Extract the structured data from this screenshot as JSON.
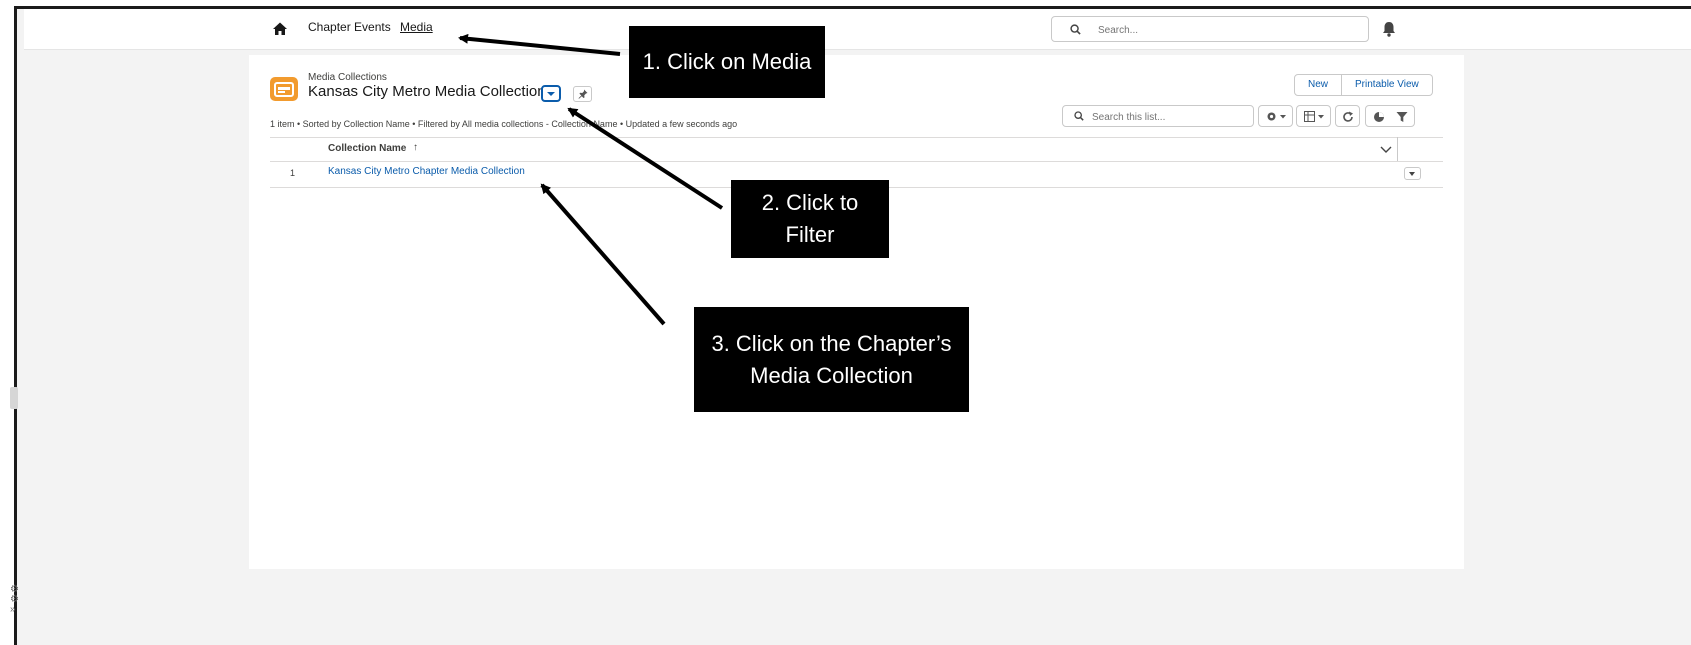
{
  "nav": {
    "home_icon": "home-icon",
    "items": [
      "Chapter Events",
      "Media"
    ],
    "search_placeholder": "Search...",
    "notifications_icon": "bell-icon"
  },
  "header": {
    "object_type": "Media Collections",
    "list_view_title": "Kansas City Metro Media Collection",
    "buttons": {
      "new": "New",
      "printable_view": "Printable View"
    },
    "meta": "1 item • Sorted by Collection Name • Filtered by All media collections - Collection Name • Updated a few seconds ago",
    "list_search_placeholder": "Search this list..."
  },
  "table": {
    "columns": [
      "Collection Name"
    ],
    "sort_indicator": "↑",
    "rows": [
      {
        "num": "1",
        "name": "Kansas City Metro Chapter Media Collection"
      }
    ]
  },
  "annotations": [
    "1. Click on Media",
    "2. Click to Filter",
    "3. Click on the Chapter’s Media Collection"
  ],
  "colors": {
    "brand_blue": "#0b5cab",
    "object_icon_orange": "#f29b2e",
    "callout_bg": "#000000",
    "callout_text": "#ffffff"
  }
}
